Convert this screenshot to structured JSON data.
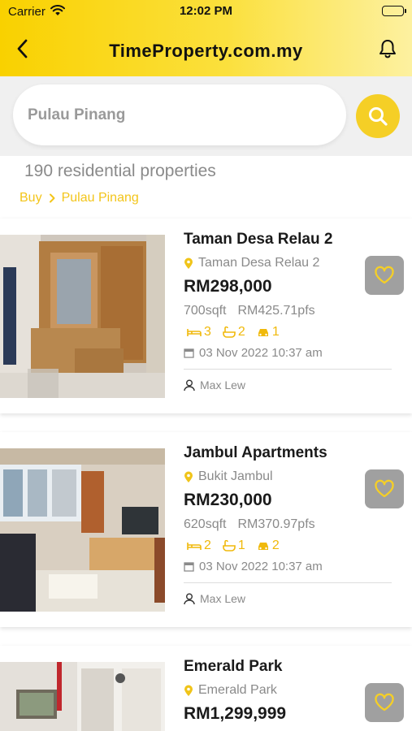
{
  "status_bar": {
    "carrier": "Carrier",
    "time": "12:02 PM"
  },
  "header": {
    "title": "TimeProperty.com.my",
    "back_icon": "chevron-left-icon",
    "bell_icon": "bell-icon"
  },
  "search": {
    "placeholder": "Pulau Pinang",
    "value": ""
  },
  "results": {
    "count_text": "190 residential properties",
    "breadcrumb": [
      "Buy",
      "Pulau Pinang"
    ]
  },
  "colors": {
    "accent": "#f5cf26",
    "feature": "#f0b90b",
    "muted": "#8a8a8a",
    "fav_bg": "#a0a0a0"
  },
  "listings": [
    {
      "name": "Taman Desa Relau 2",
      "location": "Taman Desa Relau 2",
      "price": "RM298,000",
      "size": "700sqft",
      "psf": "RM425.71pfs",
      "beds": "3",
      "baths": "2",
      "parking": "1",
      "date": "03 Nov 2022 10:37 am",
      "agent": "Max Lew"
    },
    {
      "name": "Jambul Apartments",
      "location": "Bukit Jambul",
      "price": "RM230,000",
      "size": "620sqft",
      "psf": "RM370.97pfs",
      "beds": "2",
      "baths": "1",
      "parking": "2",
      "date": "03 Nov 2022 10:37 am",
      "agent": "Max Lew"
    },
    {
      "name": "Emerald Park",
      "location": "Emerald Park",
      "price": "RM1,299,999"
    }
  ]
}
